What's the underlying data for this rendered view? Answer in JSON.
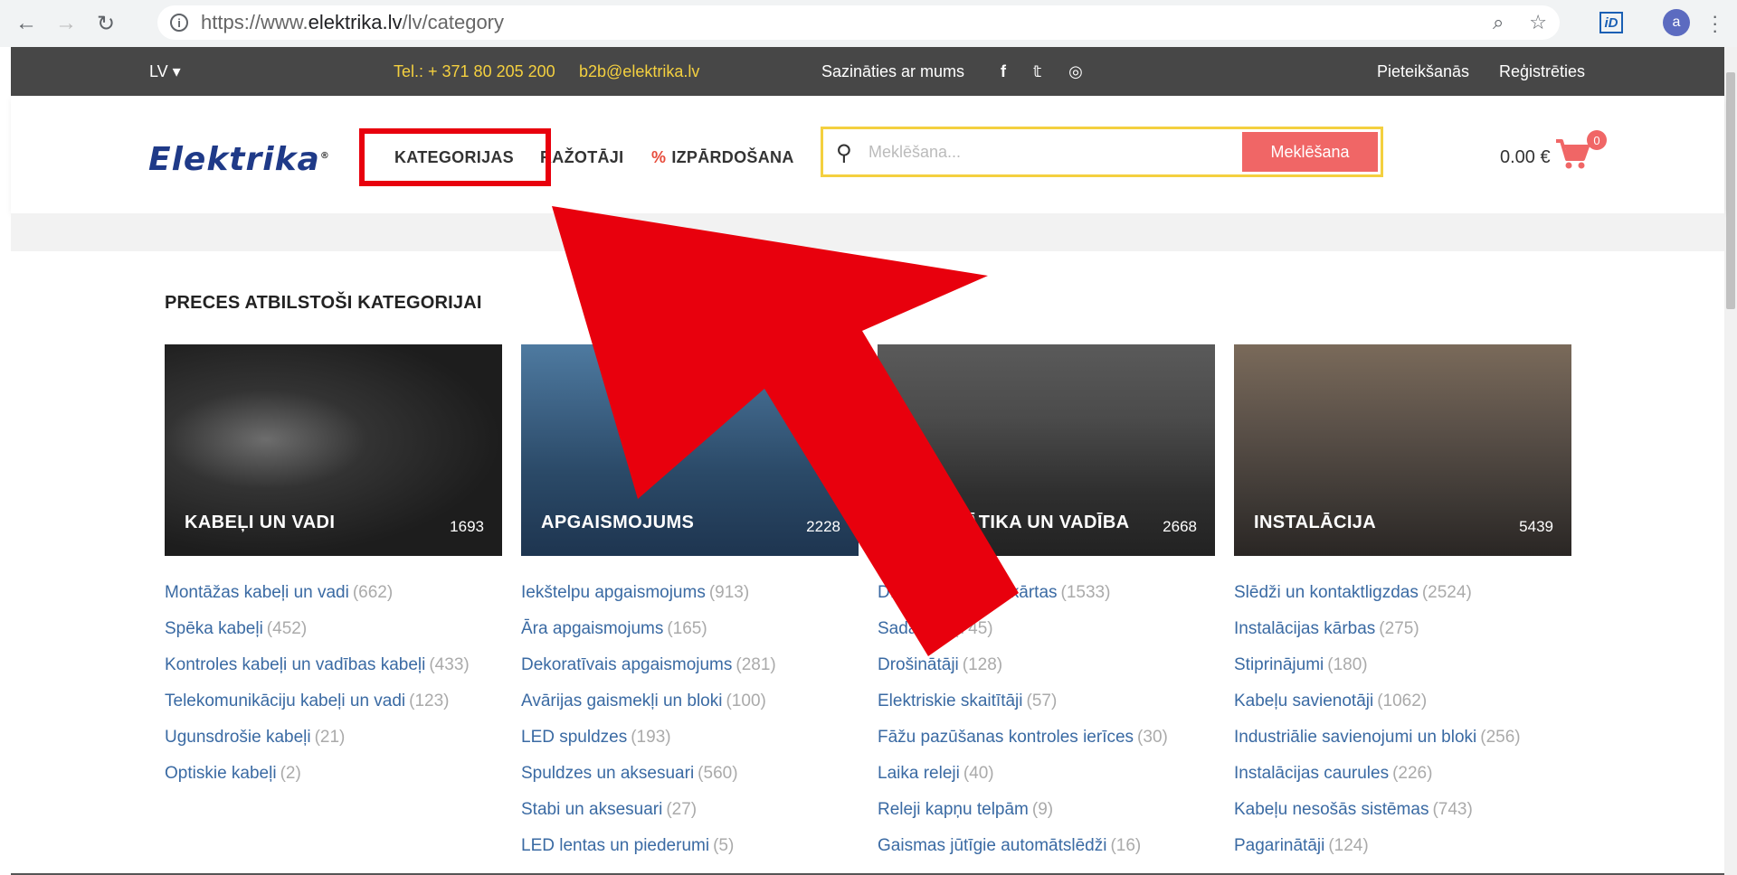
{
  "browser": {
    "url_prefix": "https://www.",
    "url_domain": "elektrika.lv",
    "url_path": "/lv/category",
    "profile_initial": "a",
    "extension_label": "iD"
  },
  "topbar": {
    "language": "LV ▾",
    "phone": "Tel.: + 371 80 205 200",
    "email": "b2b@elektrika.lv",
    "contact": "Sazināties ar mums",
    "social": [
      "facebook-icon",
      "twitter-icon",
      "instagram-icon"
    ],
    "login": "Pieteikšanās",
    "register": "Reģistrēties"
  },
  "header": {
    "logo": "Elektrika",
    "logo_mark": "®",
    "nav": {
      "categories": "KATEGORIJAS",
      "manufacturers": "RAŽOTĀJI",
      "sale_symbol": "%",
      "sale": "IZPĀRDOŠANA"
    },
    "search": {
      "placeholder": "Meklēšana...",
      "button": "Meklēšana"
    },
    "cart": {
      "total": "0.00 €",
      "count": "0"
    }
  },
  "content": {
    "title": "PRECES ATBILSTOŠI KATEGORIJAI",
    "categories": [
      {
        "name": "KABEĻI UN VADI",
        "count": "1693",
        "items": [
          {
            "label": "Montāžas kabeļi un vadi",
            "count": "(662)"
          },
          {
            "label": "Spēka kabeļi",
            "count": "(452)"
          },
          {
            "label": "Kontroles kabeļi un vadības kabeļi",
            "count": "(433)"
          },
          {
            "label": "Telekomunikāciju kabeļi un vadi",
            "count": "(123)"
          },
          {
            "label": "Ugunsdrošie kabeļi",
            "count": "(21)"
          },
          {
            "label": "Optiskie kabeļi",
            "count": "(2)"
          }
        ]
      },
      {
        "name": "APGAISMOJUMS",
        "count": "2228",
        "items": [
          {
            "label": "Iekštelpu apgaismojums",
            "count": "(913)"
          },
          {
            "label": "Āra apgaismojums",
            "count": "(165)"
          },
          {
            "label": "Dekoratīvais apgaismojums",
            "count": "(281)"
          },
          {
            "label": "Avārijas gaismekļi un bloki",
            "count": "(100)"
          },
          {
            "label": "LED spuldzes",
            "count": "(193)"
          },
          {
            "label": "Spuldzes un aksesuari",
            "count": "(560)"
          },
          {
            "label": "Stabi un aksesuari",
            "count": "(27)"
          },
          {
            "label": "LED lentas un piederumi",
            "count": "(5)"
          }
        ]
      },
      {
        "name": "AUTOMĀTIKA UN VADĪBA",
        "count": "2668",
        "items": [
          {
            "label": "DIN modulāras iekārtas",
            "count": "(1533)"
          },
          {
            "label": "Sadalnes",
            "count": "(745)"
          },
          {
            "label": "Drošinātāji",
            "count": "(128)"
          },
          {
            "label": "Elektriskie skaitītāji",
            "count": "(57)"
          },
          {
            "label": "Fāžu pazūšanas kontroles ierīces",
            "count": "(30)"
          },
          {
            "label": "Laika releji",
            "count": "(40)"
          },
          {
            "label": "Releji kapņu telpām",
            "count": "(9)"
          },
          {
            "label": "Gaismas jūtīgie automātslēdži",
            "count": "(16)"
          }
        ]
      },
      {
        "name": "INSTALĀCIJA",
        "count": "5439",
        "items": [
          {
            "label": "Slēdži un kontaktligzdas",
            "count": "(2524)"
          },
          {
            "label": "Instalācijas kārbas",
            "count": "(275)"
          },
          {
            "label": "Stiprinājumi",
            "count": "(180)"
          },
          {
            "label": "Kabeļu savienotāji",
            "count": "(1062)"
          },
          {
            "label": "Industriālie savienojumi un bloki",
            "count": "(256)"
          },
          {
            "label": "Instalācijas caurules",
            "count": "(226)"
          },
          {
            "label": "Kabeļu nesošās sistēmas",
            "count": "(743)"
          },
          {
            "label": "Pagarinātāji",
            "count": "(124)"
          }
        ]
      }
    ]
  },
  "annotation_color": "#e8000d"
}
